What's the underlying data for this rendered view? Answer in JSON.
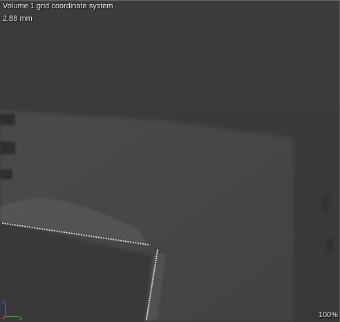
{
  "viewer": {
    "title": "Volume 1 grid coordinate system",
    "scale_text": "2.88 mm",
    "zoom_text": "100%"
  },
  "axes": {
    "z_label": "z",
    "x_label": "x",
    "colors": {
      "z": "#3a6cff",
      "x": "#2fd22f",
      "y": "#ff3030"
    }
  },
  "colors": {
    "background": "#3a3a3a",
    "phantom": "#444444",
    "text": "#ffffff"
  }
}
